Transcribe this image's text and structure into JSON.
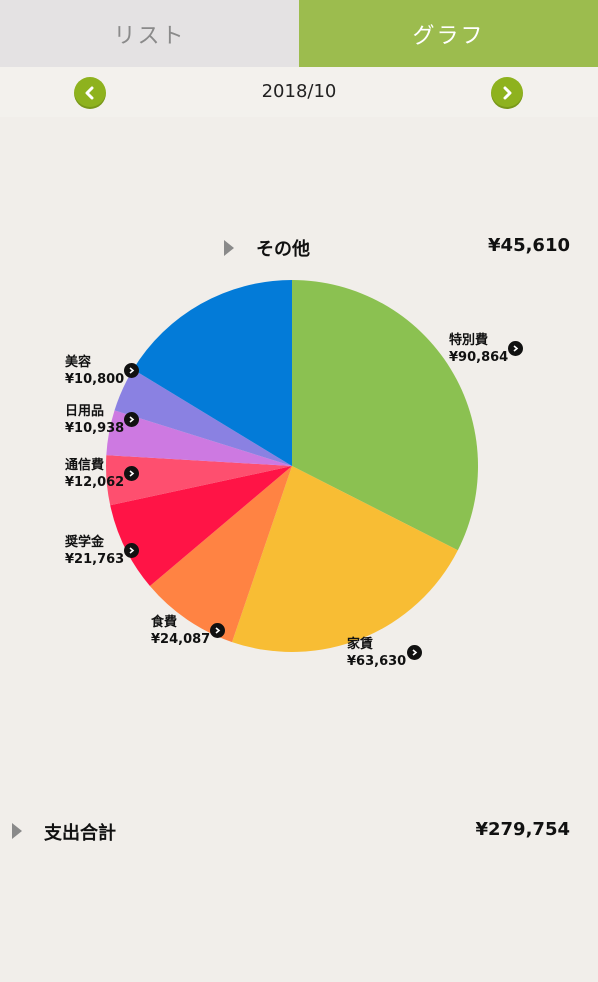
{
  "tabs": {
    "list": "リスト",
    "graph": "グラフ"
  },
  "month": "2018/10",
  "other": {
    "label": "その他",
    "value": "¥45,610"
  },
  "total": {
    "label": "支出合計",
    "value": "¥279,754"
  },
  "colors": {
    "accent": "#9cbc4e",
    "nav": "#8eb21e"
  },
  "chart_data": {
    "type": "pie",
    "slices": [
      {
        "name": "特別費",
        "value": 90864,
        "label": "¥90,864",
        "color": "#8bc151"
      },
      {
        "name": "家賃",
        "value": 63630,
        "label": "¥63,630",
        "color": "#f8bd34"
      },
      {
        "name": "食費",
        "value": 24087,
        "label": "¥24,087",
        "color": "#ff8343"
      },
      {
        "name": "奨学金",
        "value": 21763,
        "label": "¥21,763",
        "color": "#ff1446"
      },
      {
        "name": "通信費",
        "value": 12062,
        "label": "¥12,062",
        "color": "#fe4f6f"
      },
      {
        "name": "日用品",
        "value": 10938,
        "label": "¥10,938",
        "color": "#cd79e1"
      },
      {
        "name": "美容",
        "value": 10800,
        "label": "¥10,800",
        "color": "#8a81e2"
      },
      {
        "name": "その他",
        "value": 45610,
        "label": "¥45,610",
        "color": "#037bd8"
      }
    ]
  }
}
